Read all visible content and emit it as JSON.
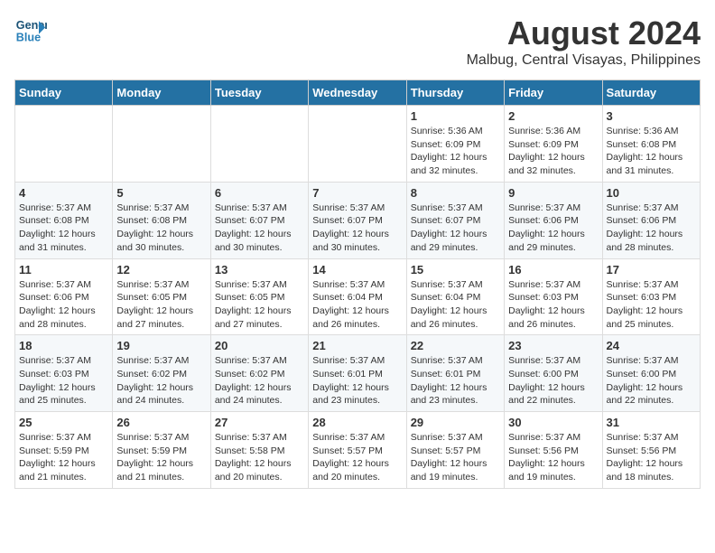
{
  "logo": {
    "line1": "General",
    "line2": "Blue"
  },
  "title": "August 2024",
  "subtitle": "Malbug, Central Visayas, Philippines",
  "days_of_week": [
    "Sunday",
    "Monday",
    "Tuesday",
    "Wednesday",
    "Thursday",
    "Friday",
    "Saturday"
  ],
  "weeks": [
    [
      {
        "day": "",
        "sunrise": "",
        "sunset": "",
        "daylight": ""
      },
      {
        "day": "",
        "sunrise": "",
        "sunset": "",
        "daylight": ""
      },
      {
        "day": "",
        "sunrise": "",
        "sunset": "",
        "daylight": ""
      },
      {
        "day": "",
        "sunrise": "",
        "sunset": "",
        "daylight": ""
      },
      {
        "day": "1",
        "sunrise": "5:36 AM",
        "sunset": "6:09 PM",
        "daylight": "12 hours and 32 minutes."
      },
      {
        "day": "2",
        "sunrise": "5:36 AM",
        "sunset": "6:09 PM",
        "daylight": "12 hours and 32 minutes."
      },
      {
        "day": "3",
        "sunrise": "5:36 AM",
        "sunset": "6:08 PM",
        "daylight": "12 hours and 31 minutes."
      }
    ],
    [
      {
        "day": "4",
        "sunrise": "5:37 AM",
        "sunset": "6:08 PM",
        "daylight": "12 hours and 31 minutes."
      },
      {
        "day": "5",
        "sunrise": "5:37 AM",
        "sunset": "6:08 PM",
        "daylight": "12 hours and 30 minutes."
      },
      {
        "day": "6",
        "sunrise": "5:37 AM",
        "sunset": "6:07 PM",
        "daylight": "12 hours and 30 minutes."
      },
      {
        "day": "7",
        "sunrise": "5:37 AM",
        "sunset": "6:07 PM",
        "daylight": "12 hours and 30 minutes."
      },
      {
        "day": "8",
        "sunrise": "5:37 AM",
        "sunset": "6:07 PM",
        "daylight": "12 hours and 29 minutes."
      },
      {
        "day": "9",
        "sunrise": "5:37 AM",
        "sunset": "6:06 PM",
        "daylight": "12 hours and 29 minutes."
      },
      {
        "day": "10",
        "sunrise": "5:37 AM",
        "sunset": "6:06 PM",
        "daylight": "12 hours and 28 minutes."
      }
    ],
    [
      {
        "day": "11",
        "sunrise": "5:37 AM",
        "sunset": "6:06 PM",
        "daylight": "12 hours and 28 minutes."
      },
      {
        "day": "12",
        "sunrise": "5:37 AM",
        "sunset": "6:05 PM",
        "daylight": "12 hours and 27 minutes."
      },
      {
        "day": "13",
        "sunrise": "5:37 AM",
        "sunset": "6:05 PM",
        "daylight": "12 hours and 27 minutes."
      },
      {
        "day": "14",
        "sunrise": "5:37 AM",
        "sunset": "6:04 PM",
        "daylight": "12 hours and 26 minutes."
      },
      {
        "day": "15",
        "sunrise": "5:37 AM",
        "sunset": "6:04 PM",
        "daylight": "12 hours and 26 minutes."
      },
      {
        "day": "16",
        "sunrise": "5:37 AM",
        "sunset": "6:03 PM",
        "daylight": "12 hours and 26 minutes."
      },
      {
        "day": "17",
        "sunrise": "5:37 AM",
        "sunset": "6:03 PM",
        "daylight": "12 hours and 25 minutes."
      }
    ],
    [
      {
        "day": "18",
        "sunrise": "5:37 AM",
        "sunset": "6:03 PM",
        "daylight": "12 hours and 25 minutes."
      },
      {
        "day": "19",
        "sunrise": "5:37 AM",
        "sunset": "6:02 PM",
        "daylight": "12 hours and 24 minutes."
      },
      {
        "day": "20",
        "sunrise": "5:37 AM",
        "sunset": "6:02 PM",
        "daylight": "12 hours and 24 minutes."
      },
      {
        "day": "21",
        "sunrise": "5:37 AM",
        "sunset": "6:01 PM",
        "daylight": "12 hours and 23 minutes."
      },
      {
        "day": "22",
        "sunrise": "5:37 AM",
        "sunset": "6:01 PM",
        "daylight": "12 hours and 23 minutes."
      },
      {
        "day": "23",
        "sunrise": "5:37 AM",
        "sunset": "6:00 PM",
        "daylight": "12 hours and 22 minutes."
      },
      {
        "day": "24",
        "sunrise": "5:37 AM",
        "sunset": "6:00 PM",
        "daylight": "12 hours and 22 minutes."
      }
    ],
    [
      {
        "day": "25",
        "sunrise": "5:37 AM",
        "sunset": "5:59 PM",
        "daylight": "12 hours and 21 minutes."
      },
      {
        "day": "26",
        "sunrise": "5:37 AM",
        "sunset": "5:59 PM",
        "daylight": "12 hours and 21 minutes."
      },
      {
        "day": "27",
        "sunrise": "5:37 AM",
        "sunset": "5:58 PM",
        "daylight": "12 hours and 20 minutes."
      },
      {
        "day": "28",
        "sunrise": "5:37 AM",
        "sunset": "5:57 PM",
        "daylight": "12 hours and 20 minutes."
      },
      {
        "day": "29",
        "sunrise": "5:37 AM",
        "sunset": "5:57 PM",
        "daylight": "12 hours and 19 minutes."
      },
      {
        "day": "30",
        "sunrise": "5:37 AM",
        "sunset": "5:56 PM",
        "daylight": "12 hours and 19 minutes."
      },
      {
        "day": "31",
        "sunrise": "5:37 AM",
        "sunset": "5:56 PM",
        "daylight": "12 hours and 18 minutes."
      }
    ]
  ]
}
